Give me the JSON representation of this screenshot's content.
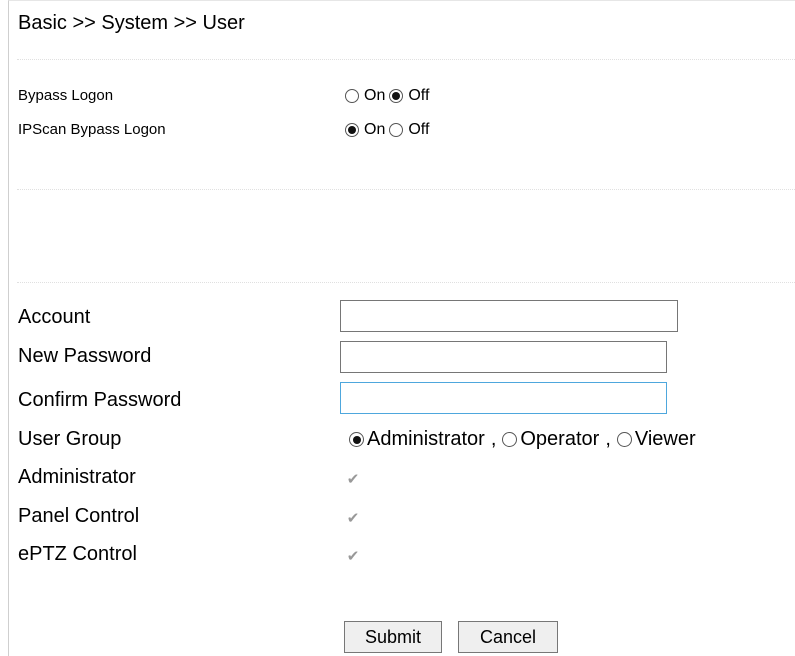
{
  "breadcrumb": "Basic >> System >> User",
  "bypass_section": {
    "bypass_logon": {
      "label": "Bypass Logon",
      "on_label": "On",
      "off_label": "Off",
      "selected": "Off"
    },
    "ipscan_bypass_logon": {
      "label": "IPScan Bypass Logon",
      "on_label": "On",
      "off_label": "Off",
      "selected": "On"
    }
  },
  "account_form": {
    "account": {
      "label": "Account",
      "value": ""
    },
    "new_password": {
      "label": "New Password",
      "value": ""
    },
    "confirm_password": {
      "label": "Confirm Password",
      "value": ""
    },
    "user_group": {
      "label": "User Group",
      "options": [
        "Administrator",
        "Operator",
        "Viewer"
      ],
      "separator": ",",
      "selected": "Administrator"
    },
    "permissions": [
      {
        "label": "Administrator",
        "checked": true,
        "disabled": true
      },
      {
        "label": "Panel Control",
        "checked": true,
        "disabled": true
      },
      {
        "label": "ePTZ Control",
        "checked": true,
        "disabled": true
      }
    ]
  },
  "buttons": {
    "submit": "Submit",
    "cancel": "Cancel"
  },
  "colors": {
    "focus_border": "#4ea7dd",
    "input_border": "#767676",
    "disabled_check": "#999999"
  }
}
